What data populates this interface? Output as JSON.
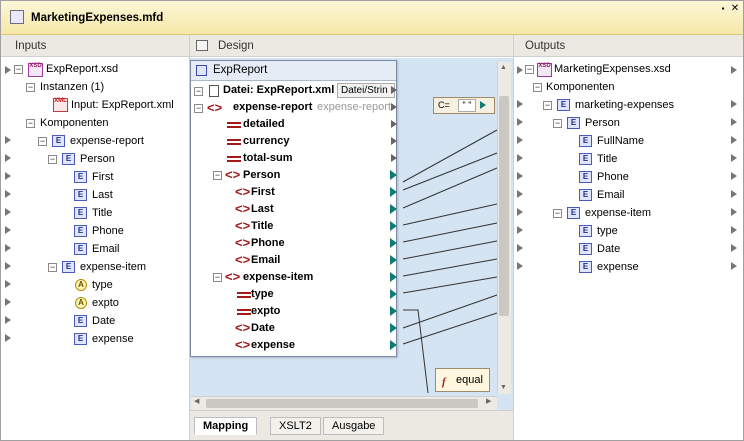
{
  "window": {
    "title": "MarketingExpenses.mfd",
    "menu_glyph": "▪",
    "close_glyph": "✕"
  },
  "inputs": {
    "header": "Inputs",
    "rows": [
      {
        "label": "ExpReport.xsd"
      },
      {
        "label": "Instanzen (1)"
      },
      {
        "label": "Input: ExpReport.xml"
      },
      {
        "label": "Komponenten"
      },
      {
        "label": "expense-report"
      },
      {
        "label": "Person"
      },
      {
        "label": "First"
      },
      {
        "label": "Last"
      },
      {
        "label": "Title"
      },
      {
        "label": "Phone"
      },
      {
        "label": "Email"
      },
      {
        "label": "expense-item"
      },
      {
        "label": "type"
      },
      {
        "label": "expto"
      },
      {
        "label": "Date"
      },
      {
        "label": "expense"
      }
    ]
  },
  "design": {
    "header": "Design",
    "component_title": "ExpReport",
    "file_row": "Datei: ExpReport.xml",
    "file_button": "Datei/Strin",
    "root_element": "expense-report",
    "root_element_ghost": "expense-report",
    "rows": [
      {
        "label": "detailed"
      },
      {
        "label": "currency"
      },
      {
        "label": "total-sum"
      },
      {
        "label": "Person"
      },
      {
        "label": "First"
      },
      {
        "label": "Last"
      },
      {
        "label": "Title"
      },
      {
        "label": "Phone"
      },
      {
        "label": "Email"
      },
      {
        "label": "expense-item"
      },
      {
        "label": "type"
      },
      {
        "label": "expto"
      },
      {
        "label": "Date"
      },
      {
        "label": "expense"
      }
    ],
    "constant_label": "C=",
    "constant_value": "\" \"",
    "function_icon": "f",
    "function_label": "equal"
  },
  "tabs": [
    {
      "label": "Mapping"
    },
    {
      "label": "XSLT2"
    },
    {
      "label": "Ausgabe"
    }
  ],
  "outputs": {
    "header": "Outputs",
    "rows": [
      {
        "label": "MarketingExpenses.xsd"
      },
      {
        "label": "Komponenten"
      },
      {
        "label": "marketing-expenses"
      },
      {
        "label": "Person"
      },
      {
        "label": "FullName"
      },
      {
        "label": "Title"
      },
      {
        "label": "Phone"
      },
      {
        "label": "Email"
      },
      {
        "label": "expense-item"
      },
      {
        "label": "type"
      },
      {
        "label": "Date"
      },
      {
        "label": "expense"
      }
    ]
  },
  "colors": {
    "titlebar": "#f5e8a8",
    "canvas": "#d5e4f2",
    "connector": "#127a74",
    "element": "#a21a1a"
  },
  "icons": {
    "element": "E",
    "attribute": "A"
  }
}
